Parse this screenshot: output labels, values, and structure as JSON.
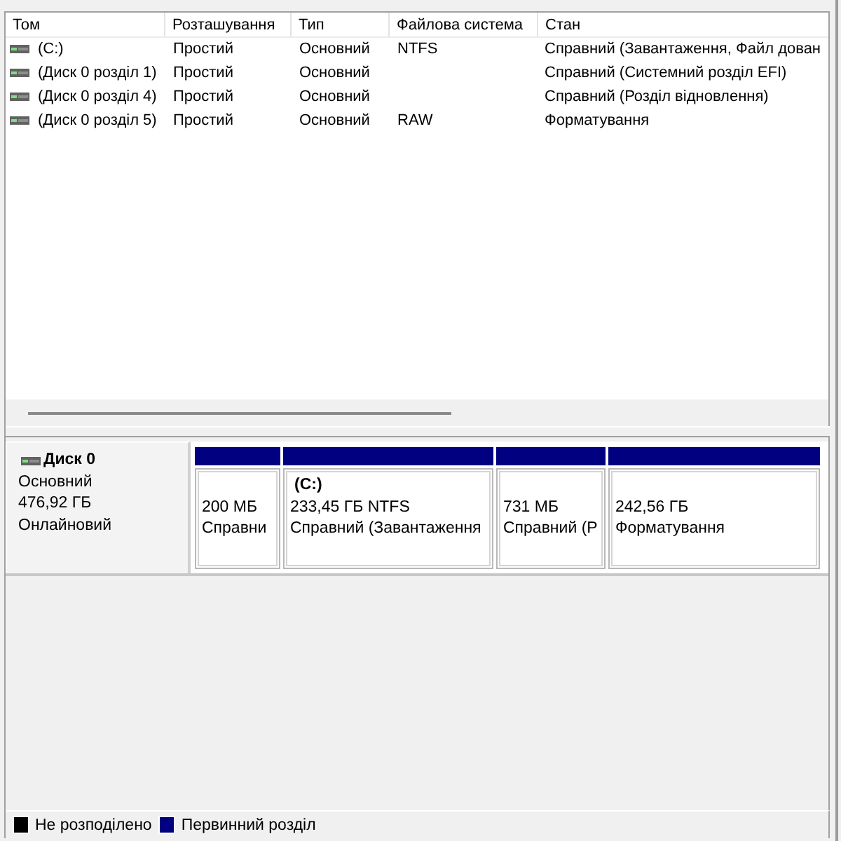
{
  "table": {
    "columns": [
      "Том",
      "Розташування",
      "Тип",
      "Файлова система",
      "Стан"
    ],
    "rows": [
      {
        "volume": "(C:)",
        "layout": "Простий",
        "type": "Основний",
        "file_system": "NTFS",
        "status": "Справний (Завантаження, Файл дован",
        "selected": false
      },
      {
        "volume": "(Диск 0 розділ 1)",
        "layout": "Простий",
        "type": "Основний",
        "status": "Справний (Системний розділ EFI)",
        "selected": false
      },
      {
        "volume": "(Диск 0 розділ 4)",
        "layout": "Простий",
        "type": "Основний",
        "status": "Справний (Розділ відновлення)",
        "selected": false
      },
      {
        "volume": "(Диск 0 розділ 5)",
        "layout": "Простий",
        "type": "Основний",
        "file_system": "RAW",
        "status": "Форматування",
        "selected": false
      }
    ]
  },
  "disks": [
    {
      "name": "Диск 0",
      "type": "Основний",
      "size": "476,92 ГБ",
      "state": "Онлайновий",
      "partitions": [
        {
          "kind": "primary",
          "size": "200 МБ",
          "status": "Справни",
          "selected": false
        },
        {
          "kind": "primary",
          "label": "(C:)",
          "size": "233,45 ГБ NTFS",
          "status": "Справний (Завантаження",
          "selected": false
        },
        {
          "kind": "primary",
          "size": "731 МБ",
          "status": "Справний (Р",
          "selected": false
        },
        {
          "kind": "primary",
          "size": "242,56 ГБ",
          "status": "Форматування",
          "selected": false
        }
      ]
    }
  ],
  "legend": [
    {
      "kind": "unallocated",
      "label": "Не розподілено",
      "color": "#000000"
    },
    {
      "kind": "primary",
      "label": "Первинний розділ",
      "color": "#000080"
    }
  ]
}
